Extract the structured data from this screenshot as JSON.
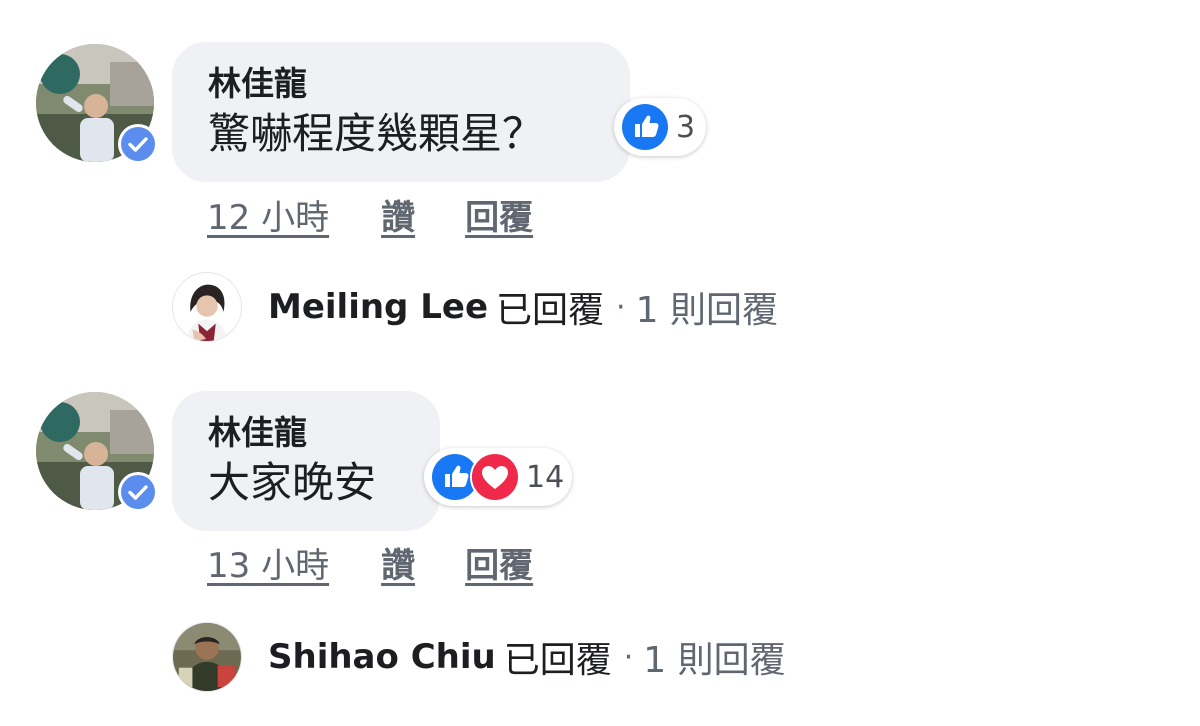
{
  "comments": [
    {
      "author": "林佳龍",
      "text": "驚嚇程度幾顆星？",
      "reaction_count": "3",
      "reactions": [
        "like-icon"
      ],
      "time": "12 小時",
      "like_label": "讚",
      "reply_label": "回覆",
      "replied": {
        "name": "Meiling Lee",
        "replied_label": "已回覆",
        "separator": "·",
        "reply_count": "1 則回覆"
      }
    },
    {
      "author": "林佳龍",
      "text": "大家晚安",
      "reaction_count": "14",
      "reactions": [
        "like-icon",
        "love-icon"
      ],
      "time": "13 小時",
      "like_label": "讚",
      "reply_label": "回覆",
      "replied": {
        "name": "Shihao Chiu",
        "replied_label": "已回覆",
        "separator": "·",
        "reply_count": "1 則回覆"
      }
    }
  ],
  "colors": {
    "bubble": "#f0f1f4",
    "like_blue": "#1877f2",
    "love_red": "#f0284a",
    "verified_blue": "#5b8def",
    "meta_gray": "#606770"
  }
}
